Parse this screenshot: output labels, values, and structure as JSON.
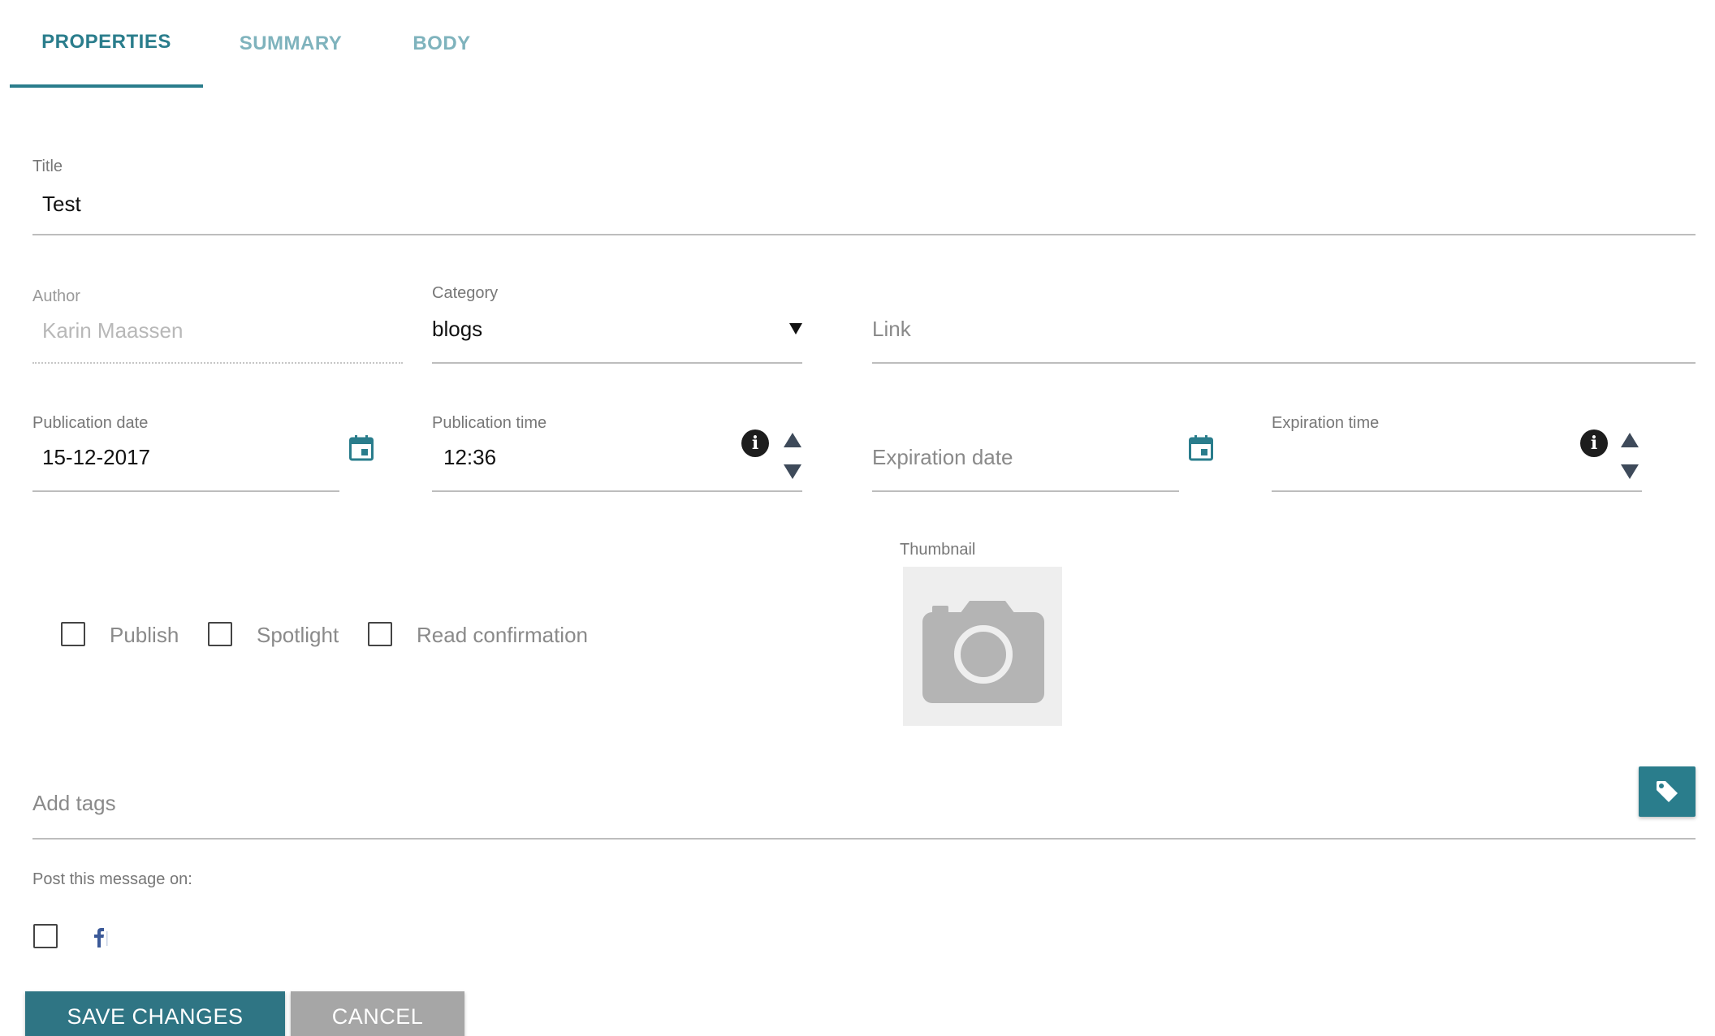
{
  "tabs": [
    {
      "label": "PROPERTIES",
      "active": true
    },
    {
      "label": "SUMMARY",
      "active": false
    },
    {
      "label": "BODY",
      "active": false
    }
  ],
  "form": {
    "title": {
      "label": "Title",
      "value": "Test"
    },
    "author": {
      "label": "Author",
      "value": "Karin Maassen"
    },
    "category": {
      "label": "Category",
      "value": "blogs"
    },
    "link": {
      "placeholder": "Link"
    },
    "publication_date": {
      "label": "Publication date",
      "value": "15-12-2017"
    },
    "publication_time": {
      "label": "Publication time",
      "value": "12:36"
    },
    "expiration_date": {
      "placeholder": "Expiration date"
    },
    "expiration_time": {
      "label": "Expiration time",
      "value": ""
    },
    "checkboxes": {
      "publish": {
        "label": "Publish",
        "checked": false
      },
      "spotlight": {
        "label": "Spotlight",
        "checked": false
      },
      "read_confirmation": {
        "label": "Read confirmation",
        "checked": false
      }
    },
    "thumbnail": {
      "label": "Thumbnail"
    },
    "tags": {
      "placeholder": "Add tags"
    },
    "post_on": {
      "label": "Post this message on:",
      "facebook_checked": false
    }
  },
  "actions": {
    "save_label": "SAVE CHANGES",
    "cancel_label": "CANCEL"
  },
  "colors": {
    "accent": "#2a7d8c",
    "tab_inactive": "#7fb3bd",
    "save_button": "#2f7584",
    "cancel_button": "#a6a6a6",
    "facebook": "#3b5998"
  },
  "icons": {
    "date_picker": "calendar-icon",
    "time_info": "info-icon",
    "thumbnail": "camera-icon",
    "tags": "tag-icon",
    "social": "facebook-icon"
  }
}
